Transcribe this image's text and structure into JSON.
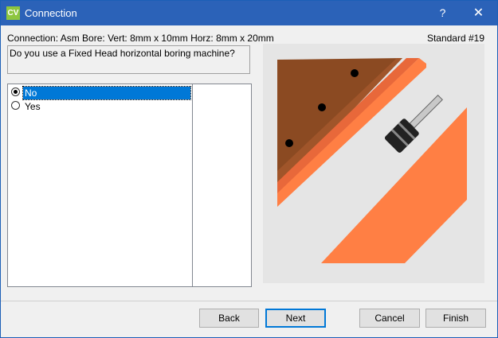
{
  "window": {
    "title": "Connection",
    "app_icon_text": "CV",
    "help_label": "?",
    "close_label": "✕"
  },
  "info": {
    "connection": "Connection: Asm Bore: Vert: 8mm x 10mm Horz: 8mm x 20mm",
    "standard": "Standard #19"
  },
  "question": "Do you use a Fixed Head horizontal boring machine?",
  "options": [
    {
      "label": "No",
      "selected": true
    },
    {
      "label": "Yes",
      "selected": false
    }
  ],
  "buttons": {
    "back": "Back",
    "next": "Next",
    "cancel": "Cancel",
    "finish": "Finish"
  },
  "colors": {
    "title_bar": "#2b62b8",
    "selection": "#0078d7",
    "panel_wood": "#8b4a22",
    "panel_edge": "#e8683a",
    "panel_orange": "#ff7f44"
  },
  "icons": [
    "app-icon",
    "help-icon",
    "close-icon",
    "radio-checked-icon",
    "radio-unchecked-icon"
  ]
}
